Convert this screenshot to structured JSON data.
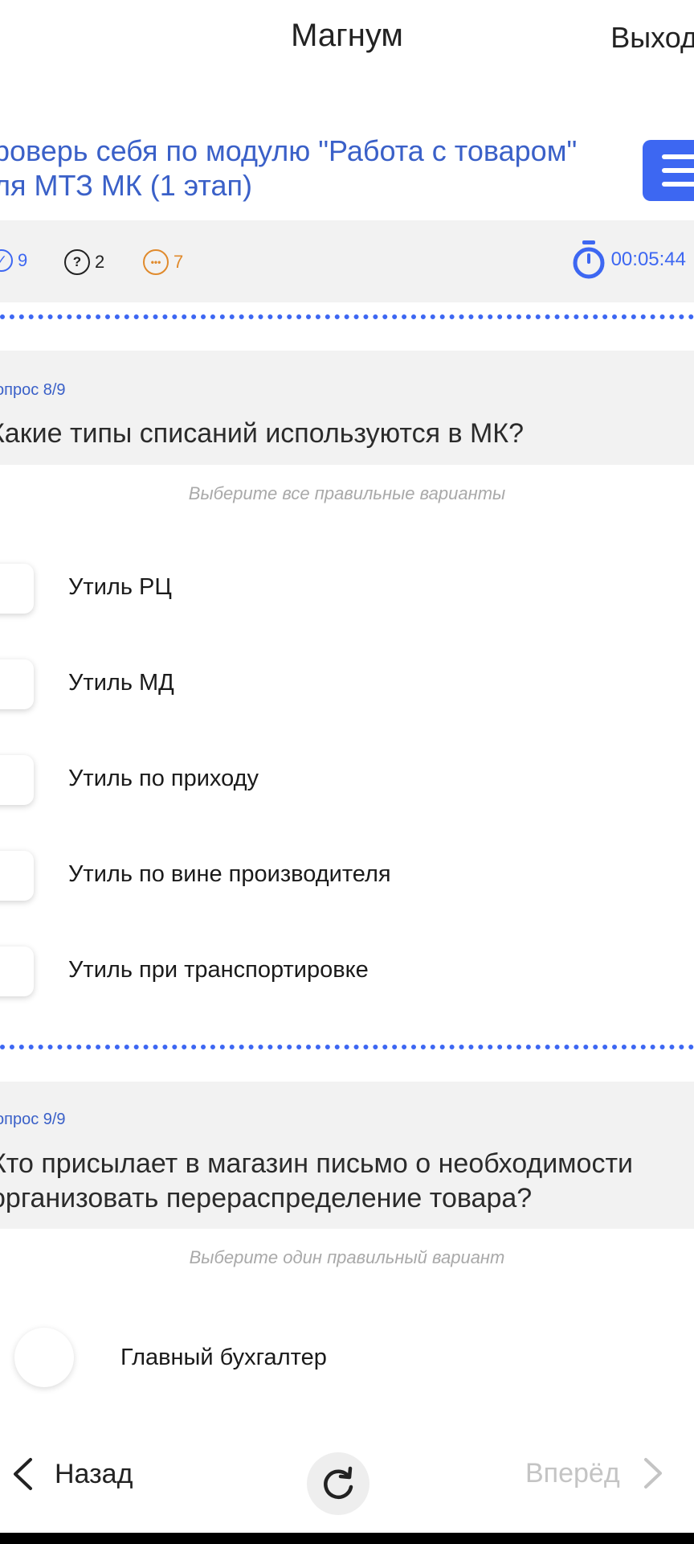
{
  "header": {
    "app_title": "Магнум",
    "exit_label": "Выход"
  },
  "test": {
    "title_line1": "роверь себя по модулю \"Работа с товаром\"",
    "title_line2": "ля МТЗ МК (1 этап)"
  },
  "stats": {
    "answered": "9",
    "unanswered": "2",
    "skipped": "7",
    "timer": "00:05:44"
  },
  "questions": [
    {
      "number": "опрос 8/9",
      "text": "Какие типы списаний используются в МК?",
      "hint": "Выберите все правильные варианты",
      "options": [
        "Утиль РЦ",
        "Утиль МД",
        "Утиль по приходу",
        "Утиль по вине производителя",
        "Утиль при транспортировке"
      ]
    },
    {
      "number": "опрос 9/9",
      "text_line1": "Кто присылает в магазин письмо о необходимости",
      "text_line2": "организовать перераспределение товара?",
      "hint": "Выберите один правильный вариант",
      "options": [
        "Главный бухгалтер"
      ]
    }
  ],
  "nav": {
    "back_label": "Назад",
    "forward_label": "Вперёд"
  },
  "colors": {
    "accent": "#3d67f2",
    "link": "#3a60c8",
    "orange": "#e08a2c"
  },
  "icons": [
    "check-circle-icon",
    "question-circle-icon",
    "dots-circle-icon",
    "stopwatch-icon",
    "menu-icon",
    "chevron-left-icon",
    "refresh-icon",
    "chevron-right-icon"
  ]
}
